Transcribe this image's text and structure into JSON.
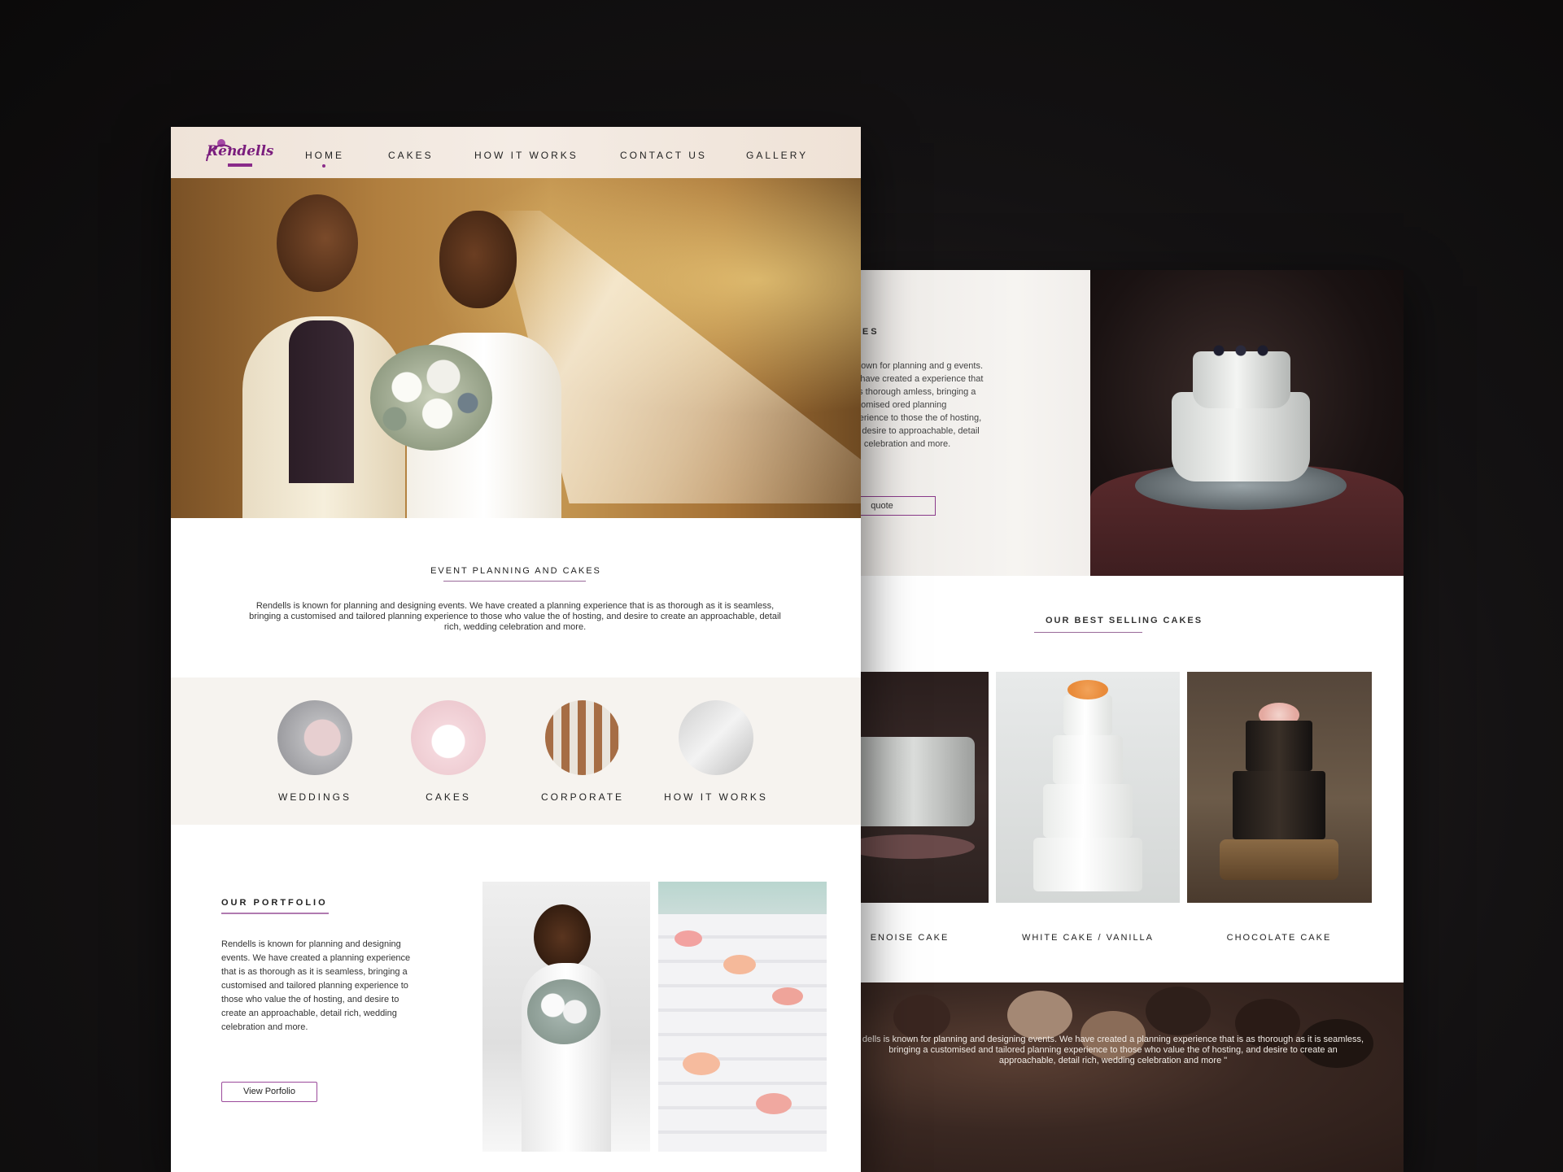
{
  "front": {
    "logo_text": "Rendells",
    "nav": [
      "HOME",
      "CAKES",
      "HOW IT WORKS",
      "CONTACT US",
      "GALLERY"
    ],
    "intro": {
      "title": "EVENT PLANNING  AND CAKES",
      "body": "Rendells is known for planning and designing events. We have created a planning experience that is as thorough as it is seamless, bringing a customised and tailored planning experience to those who value the of hosting, and desire to create an approachable, detail rich, wedding celebration and more."
    },
    "categories": [
      "WEDDINGS",
      "CAKES",
      "CORPORATE",
      "HOW IT WORKS"
    ],
    "portfolio": {
      "title": "OUR PORTFOLIO",
      "body": "Rendells is known for planning and designing events. We have created a planning experience that is as thorough as it is seamless, bringing a customised and tailored planning experience to those who value the of hosting, and desire to create an approachable, detail rich, wedding celebration and more.",
      "button": "View Porfolio"
    }
  },
  "back": {
    "section_title": "AKES",
    "body": "s known for planning and g events. We have created a experience that is as thorough amless, bringing a customised ored planning experience to those the of hosting, and desire to approachable, detail rich, celebration and more.",
    "button": "quote",
    "best_title": "OUR BEST SELLING CAKES",
    "cakes": [
      "ENOISE CAKE",
      "WHITE CAKE / VANILLA",
      "CHOCOLATE CAKE"
    ],
    "quote_text": "dells is known for planning and designing events. We have created a planning experience that is as thorough as it is seamless, bringing a customised and tailored planning experience to those who value the of hosting, and desire to create an approachable, detail rich, wedding celebration and more \""
  },
  "colors": {
    "accent": "#8a2b8a",
    "background": "#121011",
    "panel": "#f6f3ef"
  }
}
